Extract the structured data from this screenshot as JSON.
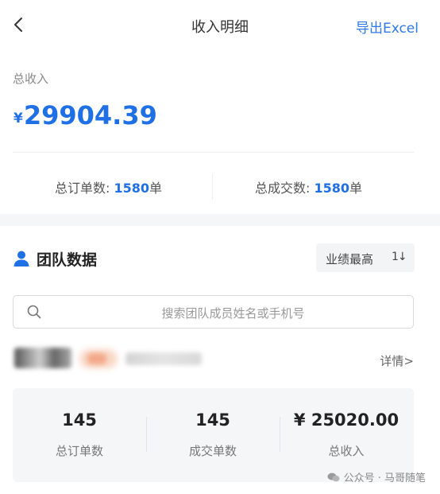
{
  "header": {
    "title": "收入明细",
    "export_label": "导出Excel"
  },
  "income": {
    "label": "总收入",
    "currency_symbol": "¥",
    "amount": "29904.39"
  },
  "stats": {
    "orders_label": "总订单数:",
    "orders_value": "1580",
    "orders_unit": "单",
    "deals_label": "总成交数:",
    "deals_value": "1580",
    "deals_unit": "单"
  },
  "team": {
    "title": "团队数据",
    "sort_label": "业绩最高",
    "sort_icon": "1↓",
    "search_placeholder": "搜索团队成员姓名或手机号"
  },
  "member": {
    "detail_label": "详情>",
    "summary": [
      {
        "value": "145",
        "label": "总订单数"
      },
      {
        "value": "145",
        "label": "成交单数"
      },
      {
        "value": "¥ 25020.00",
        "label": "总收入"
      }
    ]
  },
  "watermark": {
    "text": "公众号 · 马哥随笔"
  },
  "colors": {
    "accent": "#1f6fe5",
    "link": "#2f79e8",
    "band": "#f5f6f8"
  }
}
